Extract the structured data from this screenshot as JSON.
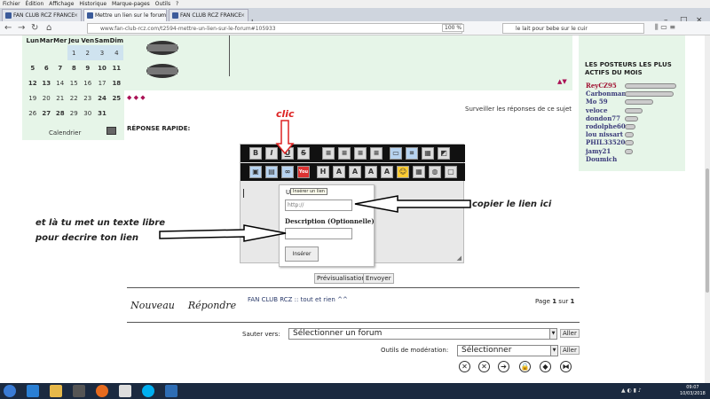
{
  "menubar": [
    "Fichier",
    "Édition",
    "Affichage",
    "Historique",
    "Marque-pages",
    "Outils",
    "?"
  ],
  "tabs": [
    {
      "label": "FAN CLUB RCZ FRANCE"
    },
    {
      "label": "Mettre un lien sur le forum"
    },
    {
      "label": "FAN CLUB RCZ FRANCE"
    }
  ],
  "address": {
    "url": "www.fan-club-rcz.com/t2594-mettre-un-lien-sur-le-forum#105933",
    "zoom": "100 %"
  },
  "search": {
    "value": "le lait pour bebe sur le cuir"
  },
  "calendar": {
    "days": [
      "Lun",
      "Mar",
      "Mer",
      "Jeu",
      "Ven",
      "Sam",
      "Dim"
    ],
    "rows": [
      [
        "",
        "",
        "",
        "",
        "1",
        "2",
        "3",
        "4"
      ],
      [
        "5",
        "6",
        "7",
        "8",
        "9",
        "10",
        "11"
      ],
      [
        "12",
        "13",
        "14",
        "15",
        "16",
        "17",
        "18"
      ],
      [
        "19",
        "20",
        "21",
        "22",
        "23",
        "24",
        "25"
      ],
      [
        "26",
        "27",
        "28",
        "29",
        "30",
        "31",
        ""
      ]
    ],
    "link": "Calendrier"
  },
  "surveiller": "Surveiller les réponses de ce sujet",
  "reponse_rapide": "RÉPONSE RAPIDE:",
  "popup": {
    "tooltip": "Insérer un lien",
    "url_label": "U",
    "url_placeholder": "http://",
    "desc_label": "Description (Optionnelle)",
    "insert_label": "Insérer"
  },
  "annotations": {
    "clic": "clic",
    "copier": "copier le lien ici",
    "texte_line1": "et là tu met un texte libre",
    "texte_line2": "pour decrire ton lien"
  },
  "posters": {
    "title": "LES POSTEURS LES PLUS ACTIFS DU MOIS",
    "list": [
      {
        "name": "ReyCZ95",
        "level": 1.0
      },
      {
        "name": "Carbonman",
        "level": 0.95
      },
      {
        "name": "Mo 59",
        "level": 0.55
      },
      {
        "name": "veloce",
        "level": 0.35
      },
      {
        "name": "dondon77",
        "level": 0.25
      },
      {
        "name": "rodolphe60",
        "level": 0.2
      },
      {
        "name": "lou nissart",
        "level": 0.18
      },
      {
        "name": "PHIL33520",
        "level": 0.18
      },
      {
        "name": "jamy21",
        "level": 0.15
      },
      {
        "name": "Doumich",
        "level": 0
      }
    ]
  },
  "buttons": {
    "previsu": "Prévisualisation",
    "envoyer": "Envoyer",
    "nouveau": "Nouveau",
    "repondre": "Répondre"
  },
  "breadcrumb": "FAN CLUB RCZ :: tout et rien ^^",
  "pageinfo": {
    "prefix": "Page",
    "current": "1",
    "sep": "sur",
    "total": "1"
  },
  "jump": {
    "label": "Sauter vers:",
    "selected": "Sélectionner un forum",
    "go": "Aller"
  },
  "moderation": {
    "label": "Outils de modération:",
    "selected": "Sélectionner",
    "go": "Aller"
  },
  "clock": {
    "time": "09:07",
    "date": "10/03/2018"
  }
}
